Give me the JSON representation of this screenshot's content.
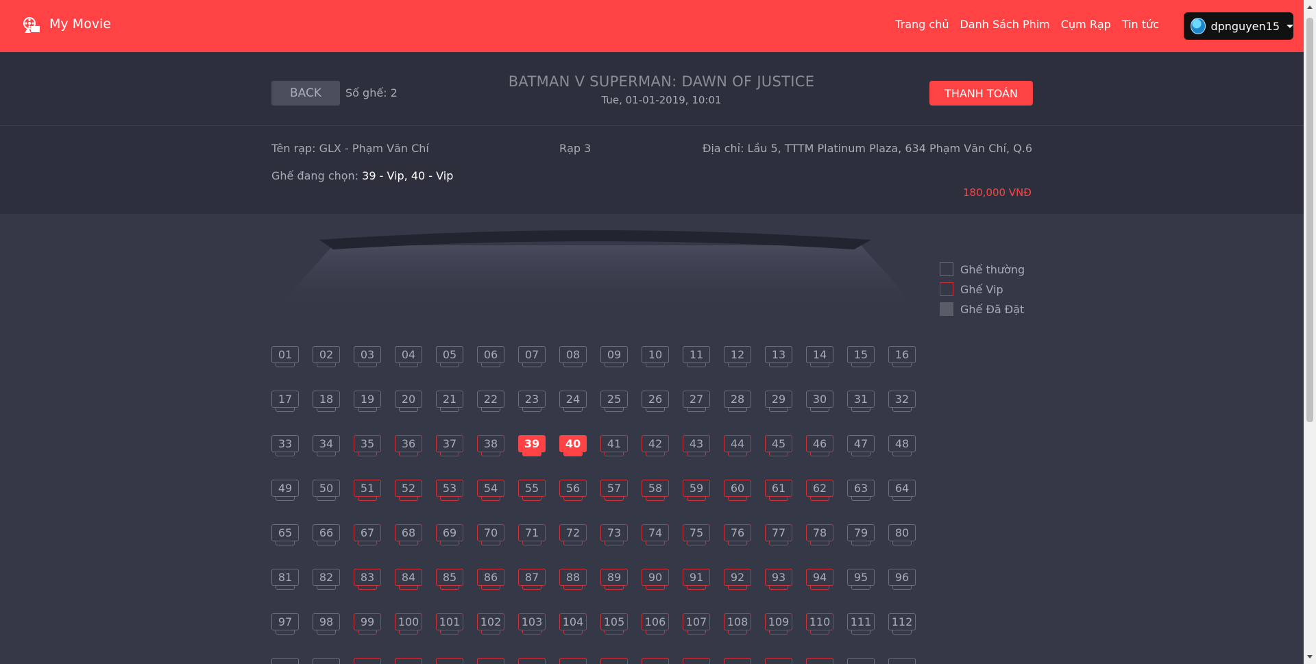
{
  "header": {
    "brand": "My Movie",
    "logo_icon": "film-reel-icon",
    "nav": [
      {
        "label": "Trang chủ"
      },
      {
        "label": "Danh Sách Phim"
      },
      {
        "label": "Cụm Rạp"
      },
      {
        "label": "Tin tức"
      }
    ],
    "user": {
      "name": "dpnguyen15",
      "avatar_icon": "user-avatar-icon"
    },
    "accent": "#ff4344"
  },
  "booking": {
    "back_label": "BACK",
    "seat_count_label": "Số ghế: 2",
    "movie_title": "BATMAN V SUPERMAN: DAWN OF JUSTICE",
    "showtime": "Tue, 01-01-2019, 10:01",
    "pay_label": "THANH TOÁN"
  },
  "info": {
    "theater": "Tên rạp: GLX - Phạm Văn Chí",
    "room": "Rạp 3",
    "address": "Địa chỉ: Lầu 5, TTTM Platinum Plaza, 634 Phạm Văn Chí, Q.6",
    "selected_label": "Ghế đang chọn:",
    "selected_seats": "39 - Vip,  40 - Vip",
    "total": "180,000 VNĐ"
  },
  "legend": [
    {
      "label": "Ghế thường",
      "type": "normal"
    },
    {
      "label": "Ghế Vip",
      "type": "vip"
    },
    {
      "label": "Ghế Đã Đặt",
      "type": "booked"
    }
  ],
  "seats": [
    {
      "n": "01",
      "t": "normal"
    },
    {
      "n": "02",
      "t": "normal"
    },
    {
      "n": "03",
      "t": "normal"
    },
    {
      "n": "04",
      "t": "normal"
    },
    {
      "n": "05",
      "t": "normal"
    },
    {
      "n": "06",
      "t": "normal"
    },
    {
      "n": "07",
      "t": "normal"
    },
    {
      "n": "08",
      "t": "normal"
    },
    {
      "n": "09",
      "t": "normal"
    },
    {
      "n": "10",
      "t": "normal"
    },
    {
      "n": "11",
      "t": "normal"
    },
    {
      "n": "12",
      "t": "normal"
    },
    {
      "n": "13",
      "t": "normal"
    },
    {
      "n": "14",
      "t": "normal"
    },
    {
      "n": "15",
      "t": "normal"
    },
    {
      "n": "16",
      "t": "normal"
    },
    {
      "n": "17",
      "t": "normal"
    },
    {
      "n": "18",
      "t": "normal"
    },
    {
      "n": "19",
      "t": "normal"
    },
    {
      "n": "20",
      "t": "normal"
    },
    {
      "n": "21",
      "t": "normal"
    },
    {
      "n": "22",
      "t": "normal"
    },
    {
      "n": "23",
      "t": "normal"
    },
    {
      "n": "24",
      "t": "normal"
    },
    {
      "n": "25",
      "t": "normal"
    },
    {
      "n": "26",
      "t": "normal"
    },
    {
      "n": "27",
      "t": "normal"
    },
    {
      "n": "28",
      "t": "normal"
    },
    {
      "n": "29",
      "t": "normal"
    },
    {
      "n": "30",
      "t": "normal"
    },
    {
      "n": "31",
      "t": "normal"
    },
    {
      "n": "32",
      "t": "normal"
    },
    {
      "n": "33",
      "t": "normal"
    },
    {
      "n": "34",
      "t": "normal"
    },
    {
      "n": "35",
      "t": "vip"
    },
    {
      "n": "36",
      "t": "vip"
    },
    {
      "n": "37",
      "t": "vip"
    },
    {
      "n": "38",
      "t": "vip"
    },
    {
      "n": "39",
      "t": "selected"
    },
    {
      "n": "40",
      "t": "selected"
    },
    {
      "n": "41",
      "t": "vip"
    },
    {
      "n": "42",
      "t": "vip"
    },
    {
      "n": "43",
      "t": "vip"
    },
    {
      "n": "44",
      "t": "vip"
    },
    {
      "n": "45",
      "t": "vip"
    },
    {
      "n": "46",
      "t": "vip"
    },
    {
      "n": "47",
      "t": "normal"
    },
    {
      "n": "48",
      "t": "normal"
    },
    {
      "n": "49",
      "t": "normal"
    },
    {
      "n": "50",
      "t": "normal"
    },
    {
      "n": "51",
      "t": "vip"
    },
    {
      "n": "52",
      "t": "vip"
    },
    {
      "n": "53",
      "t": "vip"
    },
    {
      "n": "54",
      "t": "vip"
    },
    {
      "n": "55",
      "t": "vip"
    },
    {
      "n": "56",
      "t": "vip"
    },
    {
      "n": "57",
      "t": "vip"
    },
    {
      "n": "58",
      "t": "vip"
    },
    {
      "n": "59",
      "t": "vip"
    },
    {
      "n": "60",
      "t": "vip"
    },
    {
      "n": "61",
      "t": "vip"
    },
    {
      "n": "62",
      "t": "vip"
    },
    {
      "n": "63",
      "t": "normal"
    },
    {
      "n": "64",
      "t": "normal"
    },
    {
      "n": "65",
      "t": "normal"
    },
    {
      "n": "66",
      "t": "normal"
    },
    {
      "n": "67",
      "t": "vip"
    },
    {
      "n": "68",
      "t": "vip"
    },
    {
      "n": "69",
      "t": "vip"
    },
    {
      "n": "70",
      "t": "vip"
    },
    {
      "n": "71",
      "t": "vip"
    },
    {
      "n": "72",
      "t": "vip"
    },
    {
      "n": "73",
      "t": "vip"
    },
    {
      "n": "74",
      "t": "vip"
    },
    {
      "n": "75",
      "t": "vip"
    },
    {
      "n": "76",
      "t": "vip"
    },
    {
      "n": "77",
      "t": "vip"
    },
    {
      "n": "78",
      "t": "vip"
    },
    {
      "n": "79",
      "t": "normal"
    },
    {
      "n": "80",
      "t": "normal"
    },
    {
      "n": "81",
      "t": "normal"
    },
    {
      "n": "82",
      "t": "normal"
    },
    {
      "n": "83",
      "t": "vip"
    },
    {
      "n": "84",
      "t": "vip"
    },
    {
      "n": "85",
      "t": "vip"
    },
    {
      "n": "86",
      "t": "vip"
    },
    {
      "n": "87",
      "t": "vip"
    },
    {
      "n": "88",
      "t": "vip"
    },
    {
      "n": "89",
      "t": "vip"
    },
    {
      "n": "90",
      "t": "vip"
    },
    {
      "n": "91",
      "t": "vip"
    },
    {
      "n": "92",
      "t": "vip"
    },
    {
      "n": "93",
      "t": "vip"
    },
    {
      "n": "94",
      "t": "vip"
    },
    {
      "n": "95",
      "t": "normal"
    },
    {
      "n": "96",
      "t": "normal"
    },
    {
      "n": "97",
      "t": "normal"
    },
    {
      "n": "98",
      "t": "normal"
    },
    {
      "n": "99",
      "t": "vip"
    },
    {
      "n": "100",
      "t": "vip"
    },
    {
      "n": "101",
      "t": "vip"
    },
    {
      "n": "102",
      "t": "vip"
    },
    {
      "n": "103",
      "t": "vip"
    },
    {
      "n": "104",
      "t": "vip"
    },
    {
      "n": "105",
      "t": "vip"
    },
    {
      "n": "106",
      "t": "vip"
    },
    {
      "n": "107",
      "t": "vip"
    },
    {
      "n": "108",
      "t": "vip"
    },
    {
      "n": "109",
      "t": "vip"
    },
    {
      "n": "110",
      "t": "vip"
    },
    {
      "n": "111",
      "t": "normal"
    },
    {
      "n": "112",
      "t": "normal"
    },
    {
      "n": "",
      "t": "normal"
    },
    {
      "n": "",
      "t": "normal"
    },
    {
      "n": "",
      "t": "vip"
    },
    {
      "n": "",
      "t": "vip"
    },
    {
      "n": "",
      "t": "vip"
    },
    {
      "n": "",
      "t": "vip"
    },
    {
      "n": "",
      "t": "vip"
    },
    {
      "n": "",
      "t": "vip"
    },
    {
      "n": "",
      "t": "vip"
    },
    {
      "n": "",
      "t": "vip"
    },
    {
      "n": "",
      "t": "vip"
    },
    {
      "n": "",
      "t": "vip"
    },
    {
      "n": "",
      "t": "vip"
    },
    {
      "n": "",
      "t": "vip"
    },
    {
      "n": "",
      "t": "normal"
    },
    {
      "n": "",
      "t": "normal"
    }
  ]
}
